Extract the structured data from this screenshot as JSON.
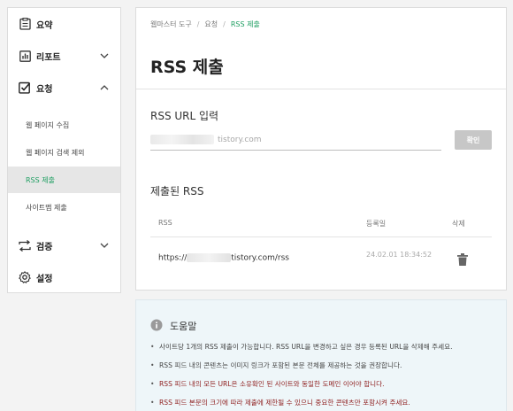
{
  "sidebar": {
    "items": [
      {
        "label": "요약",
        "icon": "summary-icon"
      },
      {
        "label": "리포트",
        "icon": "report-icon"
      },
      {
        "label": "요청",
        "icon": "request-checkbox-icon"
      },
      {
        "label": "검증",
        "icon": "verify-icon"
      },
      {
        "label": "설정",
        "icon": "settings-gear-icon"
      }
    ],
    "sub_items": [
      {
        "label": "웹 페이지 수집"
      },
      {
        "label": "웹 페이지 검색 제외"
      },
      {
        "label": "RSS 제출"
      },
      {
        "label": "사이트맵 제출"
      }
    ]
  },
  "main": {
    "breadcrumb": [
      "웹마스터 도구",
      "요청",
      "RSS 제출"
    ],
    "title": "RSS 제출",
    "input_section_title": "RSS URL 입력",
    "input_placeholder": "tistory.com",
    "confirm_label": "확인",
    "list_section_title": "제출된 RSS",
    "columns": [
      "RSS",
      "등록일",
      "삭제"
    ],
    "rows": [
      {
        "url_prefix": "https://",
        "url_suffix": "tistory.com/rss",
        "date": "24.02.01 18:34:52"
      }
    ]
  },
  "help": {
    "title": "도움말",
    "items": [
      "사이트당 1개의 RSS 제출이 가능합니다. RSS URL을 변경하고 싶은 경우 등록된 URL을 삭제해 주세요.",
      "RSS 피드 내의 콘텐츠는 이미지 링크가 포함된 본문 전체를 제공하는 것을 권장합니다.",
      "RSS 피드 내의 모든 URL은 소유확인 된 사이트와 동일한 도메인 이어야 합니다.",
      "RSS 피드 본문의 크기에 따라 제출에 제한될 수 있으니 중요한 콘텐츠만 포함시켜 주세요."
    ]
  },
  "colors": {
    "accent": "#1e9e61",
    "warning_text": "#8e1d1d",
    "help_bg": "#eef6f9"
  }
}
